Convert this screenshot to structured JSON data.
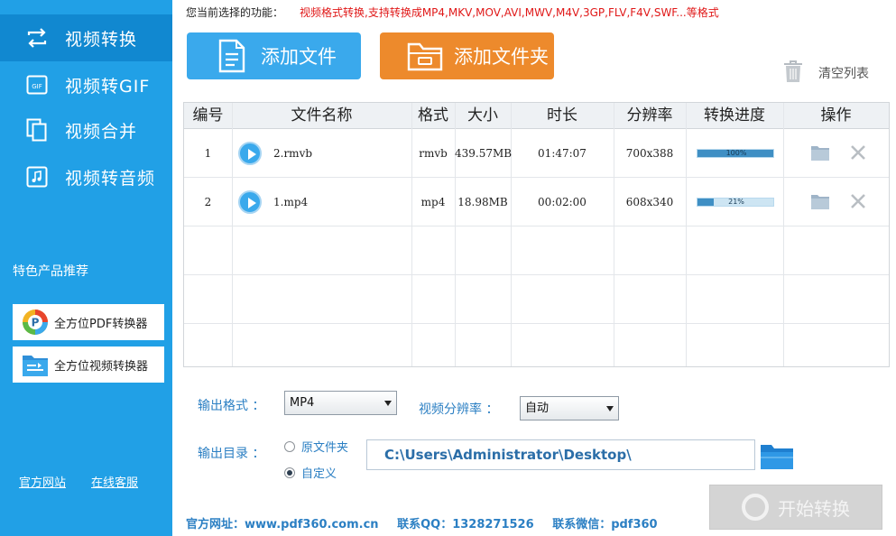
{
  "sidebar": {
    "items": [
      {
        "label": "视频转换",
        "icon": "convert-icon",
        "active": true
      },
      {
        "label": "视频转GIF",
        "icon": "gif-icon",
        "active": false
      },
      {
        "label": "视频合并",
        "icon": "merge-icon",
        "active": false
      },
      {
        "label": "视频转音频",
        "icon": "music-icon",
        "active": false
      }
    ],
    "featured_title": "特色产品推荐",
    "promos": [
      {
        "label": "全方位PDF转换器",
        "icon": "pdf-converter-logo-icon"
      },
      {
        "label": "全方位视频转换器",
        "icon": "video-converter-logo-icon"
      }
    ],
    "links": {
      "official_site": "官方网站",
      "online_support": "在线客服"
    }
  },
  "header": {
    "function_label": "您当前选择的功能：",
    "function_value": "视频格式转换,支持转换成MP4,MKV,MOV,AVI,MWV,M4V,3GP,FLV,F4V,SWF...等格式"
  },
  "toolbar": {
    "add_file": "添加文件",
    "add_folder": "添加文件夹",
    "clear_list": "清空列表"
  },
  "table": {
    "headers": {
      "index": "编号",
      "name": "文件名称",
      "format": "格式",
      "size": "大小",
      "duration": "时长",
      "resolution": "分辨率",
      "progress": "转换进度",
      "actions": "操作"
    },
    "rows": [
      {
        "index": "1",
        "name": "2.rmvb",
        "format": "rmvb",
        "size": "439.57MB",
        "duration": "01:47:07",
        "resolution": "700x388",
        "progress_label": "100%",
        "progress": 1.0
      },
      {
        "index": "2",
        "name": "1.mp4",
        "format": "mp4",
        "size": "18.98MB",
        "duration": "00:02:00",
        "resolution": "608x340",
        "progress_label": "21%",
        "progress": 0.21
      }
    ]
  },
  "settings": {
    "output_format_label": "输出格式 ：",
    "output_format_value": "MP4",
    "resolution_label": "视频分辨率 ：",
    "resolution_value": "自动",
    "output_dir_label": "输出目录 ：",
    "radio_original": "原文件夹",
    "radio_custom": "自定义",
    "selected_radio": "custom",
    "output_path": "C:\\Users\\Administrator\\Desktop\\"
  },
  "start_button": "开始转换",
  "footer": {
    "site": "官方网址：www.pdf360.com.cn",
    "qq": "联系QQ：1328271526",
    "wechat": "联系微信：pdf360"
  },
  "colors": {
    "sidebar_bg": "#21a0e6",
    "sidebar_active": "#1188d0",
    "primary_blue": "#3aa9ec",
    "orange": "#ed8a2c",
    "label_blue": "#2b7fc3",
    "warning_red": "#e01818"
  }
}
